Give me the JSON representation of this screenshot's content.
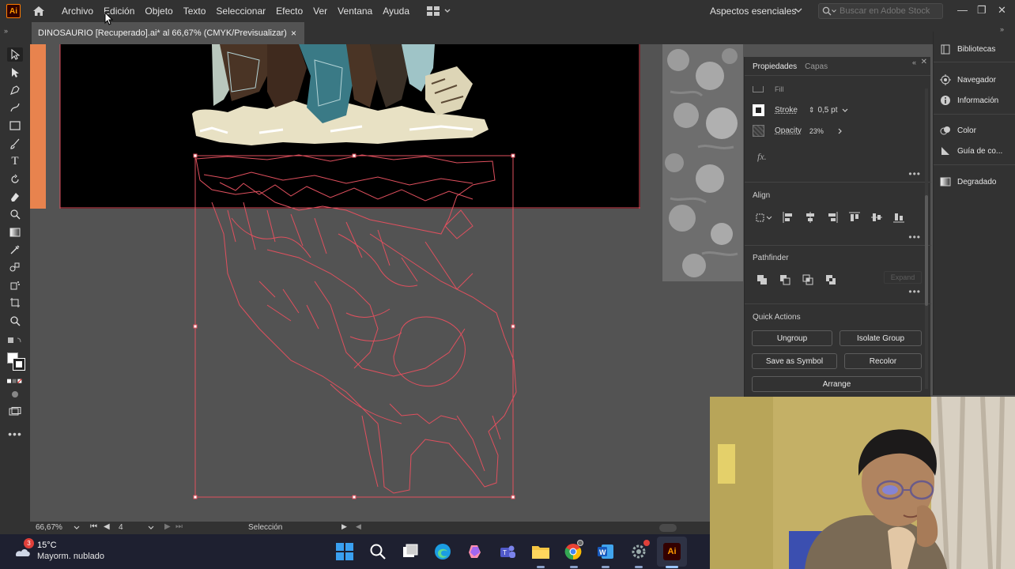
{
  "app": {
    "logo": "Ai"
  },
  "menu": [
    "Archivo",
    "Edición",
    "Objeto",
    "Texto",
    "Seleccionar",
    "Efecto",
    "Ver",
    "Ventana",
    "Ayuda"
  ],
  "workspace": "Aspectos esenciales",
  "stock_search": {
    "placeholder": "Buscar en Adobe Stock"
  },
  "document_tab": {
    "title": "DINOSAURIO [Recuperado].ai* al 66,67% (CMYK/Previsualizar)",
    "close": "×"
  },
  "properties": {
    "tabs": [
      "Propiedades",
      "Capas"
    ],
    "fill_label": "Fill",
    "stroke_label": "Stroke",
    "stroke_value": "0,5 pt",
    "opacity_label": "Opacity",
    "opacity_value": "23%",
    "fx_label": "fx.",
    "align_title": "Align",
    "pathfinder_title": "Pathfinder",
    "expand_label": "Expand",
    "quick_actions_title": "Quick Actions",
    "buttons": {
      "ungroup": "Ungroup",
      "isolate_group": "Isolate Group",
      "save_as_symbol": "Save as Symbol",
      "recolor": "Recolor",
      "arrange": "Arrange"
    }
  },
  "side_panels": [
    "Bibliotecas",
    "Navegador",
    "Información",
    "Color",
    "Guía de co...",
    "Degradado"
  ],
  "status": {
    "zoom": "66,67%",
    "artboard": "4",
    "tool": "Selección"
  },
  "taskbar": {
    "temperature": "15°C",
    "weather": "Mayorm. nublado",
    "badge": "3"
  },
  "colors": {
    "accent_orange": "#e8834e",
    "selection_red": "#e0505e",
    "ui_dark": "#323232",
    "canvas_gray": "#535353"
  }
}
